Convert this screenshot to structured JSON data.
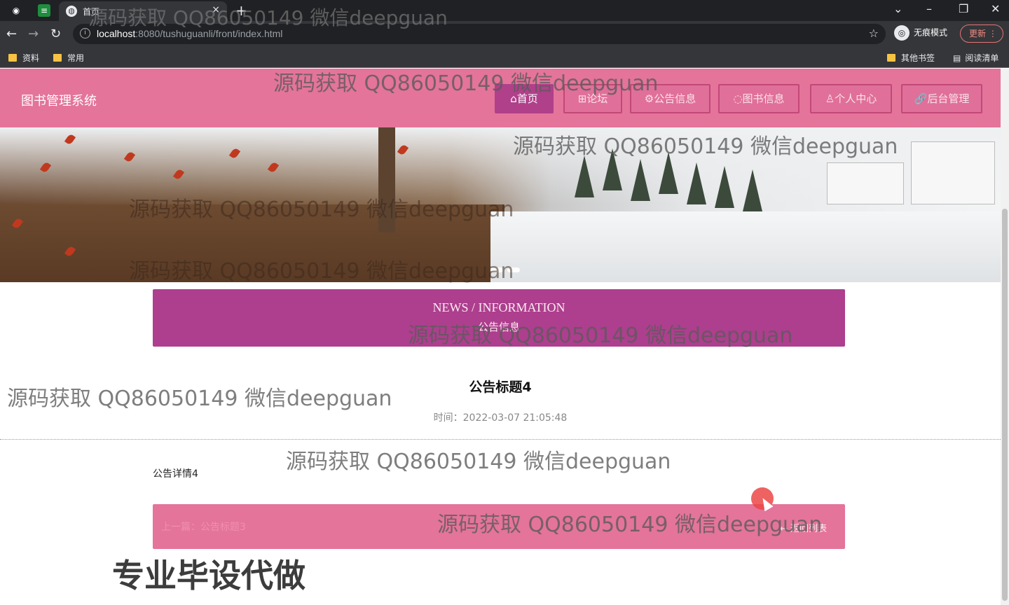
{
  "browser": {
    "tab_title": "首页",
    "tab_close": "×",
    "new_tab": "+",
    "url_host": "localhost",
    "url_rest": ":8080/tushuguanli/front/index.html",
    "incognito_label": "无痕模式",
    "update_label": "更新 ⋮",
    "bookmarks": [
      "资料",
      "常用"
    ],
    "other_bookmarks": "其他书签",
    "reading_list": "阅读清单"
  },
  "site": {
    "logo": "图书管理系统",
    "nav": [
      {
        "label": "⌂首页",
        "active": true
      },
      {
        "label": "⊞论坛",
        "active": false
      },
      {
        "label": "⚙公告信息",
        "active": false
      },
      {
        "label": "◌图书信息",
        "active": false
      },
      {
        "label": "♙个人中心",
        "active": false
      },
      {
        "label": "🔗后台管理",
        "active": false
      }
    ]
  },
  "section": {
    "title_en": "NEWS / INFORMATION",
    "title_cn": "公告信息"
  },
  "article": {
    "title": "公告标题4",
    "time_label": "时间：",
    "time_value": "2022-03-07 21:05:48",
    "body": "公告详情4"
  },
  "pager": {
    "prev": "上一篇：公告标题3",
    "back": "← 返回列表"
  },
  "watermarks": {
    "text": "源码获取 QQ86050149 微信deepguan",
    "big": "专业毕设代做"
  },
  "colors": {
    "header": "#e4749a",
    "nav_active": "#b0408a",
    "news_bar": "#ad3f8e"
  }
}
